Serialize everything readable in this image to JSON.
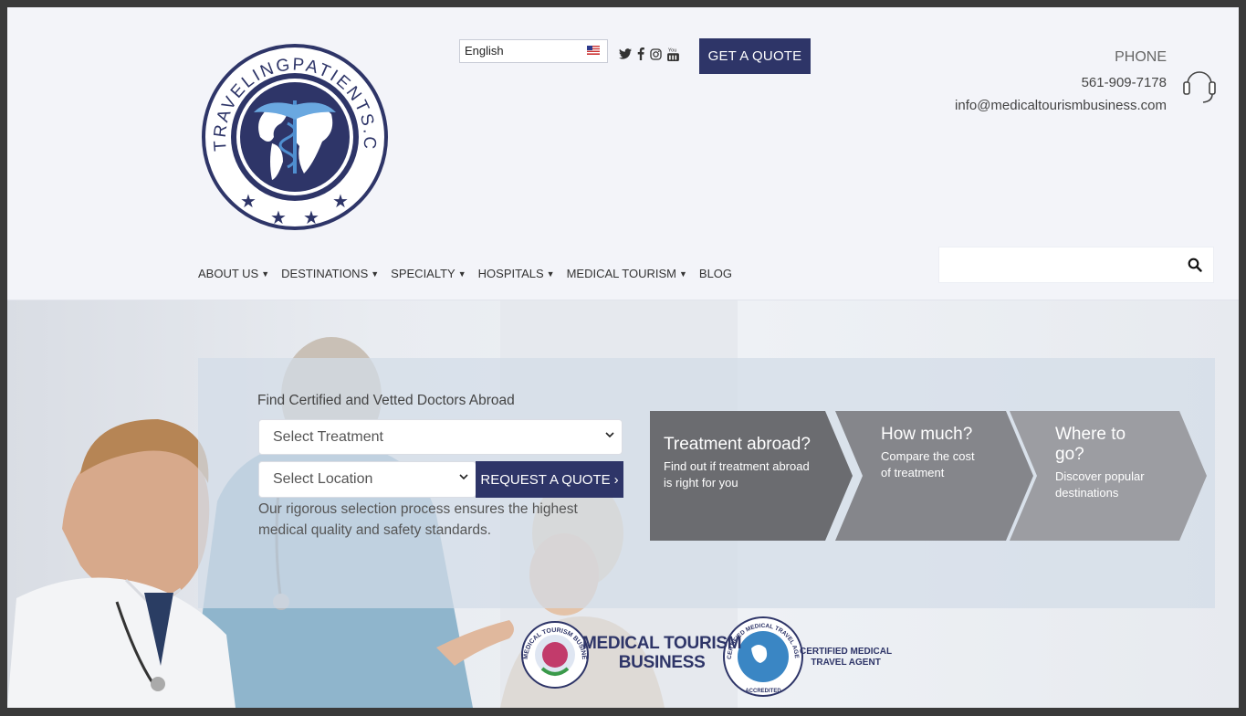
{
  "logo": {
    "arc_text": "TRAVELINGPATIENTS.COM"
  },
  "topbar": {
    "language": "English",
    "quote_button": "GET A QUOTE",
    "social_icons": [
      "twitter-icon",
      "facebook-icon",
      "instagram-icon",
      "youtube-icon"
    ]
  },
  "contact": {
    "label": "PHONE",
    "phone": "561-909-7178",
    "email": "info@medicaltourismbusiness.com"
  },
  "nav": {
    "items": [
      {
        "label": "ABOUT US",
        "dropdown": true
      },
      {
        "label": "DESTINATIONS",
        "dropdown": true
      },
      {
        "label": "SPECIALTY",
        "dropdown": true
      },
      {
        "label": "HOSPITALS",
        "dropdown": true
      },
      {
        "label": "MEDICAL TOURISM",
        "dropdown": true
      },
      {
        "label": "BLOG",
        "dropdown": false
      }
    ]
  },
  "search": {
    "placeholder": ""
  },
  "finder": {
    "title": "Find Certified and Vetted Doctors Abroad",
    "treatment_select": "Select Treatment",
    "location_select": "Select Location",
    "request_button": "REQUEST A QUOTE",
    "request_chevron": "›",
    "description": "Our rigorous selection process ensures the highest medical quality and safety standards."
  },
  "steps": [
    {
      "title": "Treatment abroad?",
      "text": "Find out if treatment abroad is right for you",
      "color": "#6b6c70"
    },
    {
      "title": "How much?",
      "text": "Compare the cost of treatment",
      "color": "#85868b"
    },
    {
      "title": "Where to go?",
      "text": "Discover popular destinations",
      "color": "#9c9da2"
    }
  ],
  "badges": {
    "badge1_line1": "MEDICAL TOURISM",
    "badge1_line2": "BUSINESS",
    "badge1_ring": "MEDICAL TOURISM BUSINESS",
    "badge2_line1": "CERTIFIED MEDICAL",
    "badge2_line2": "TRAVEL AGENT",
    "badge2_ring": "CERTIFIED MEDICAL TRAVEL AGENT",
    "badge2_bottom": "ACCREDITED"
  },
  "colors": {
    "brand_navy": "#2e3568",
    "page_bg": "#f3f4f9"
  }
}
